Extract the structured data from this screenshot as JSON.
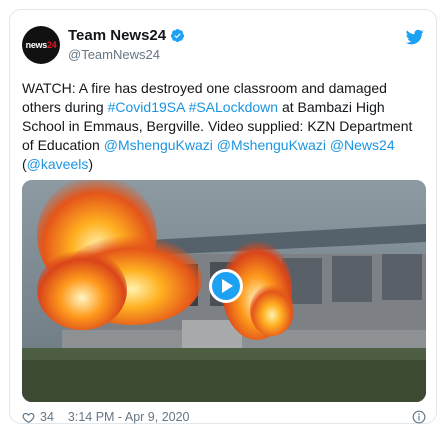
{
  "account": {
    "name": "Team News24",
    "handle": "@TeamNews24",
    "avatar_text": "news",
    "avatar_num": "24"
  },
  "tweet": {
    "p1": "WATCH: A fire has destroyed one classroom and damaged others during ",
    "tag1": "#Covid19SA",
    "tag2": "#SALockdown",
    "p2": " at Bambazi High School in Emmaus, Bergville. Video supplied: KZN Department of Education ",
    "m1": "@MshenguKwazi",
    "m2": "@MshenguKwazi",
    "m3": "@News24",
    "p3": "(",
    "m4": "@kaveels",
    "p4": ")"
  },
  "footer": {
    "likes": "34",
    "timestamp": "3:14 PM - Apr 9, 2020"
  },
  "colors": {
    "link": "#1b95e0",
    "twitter_blue": "#1da1f2",
    "muted": "#657786"
  },
  "icons": [
    "verified-icon",
    "twitter-bird-icon",
    "play-icon",
    "heart-icon",
    "info-icon"
  ]
}
